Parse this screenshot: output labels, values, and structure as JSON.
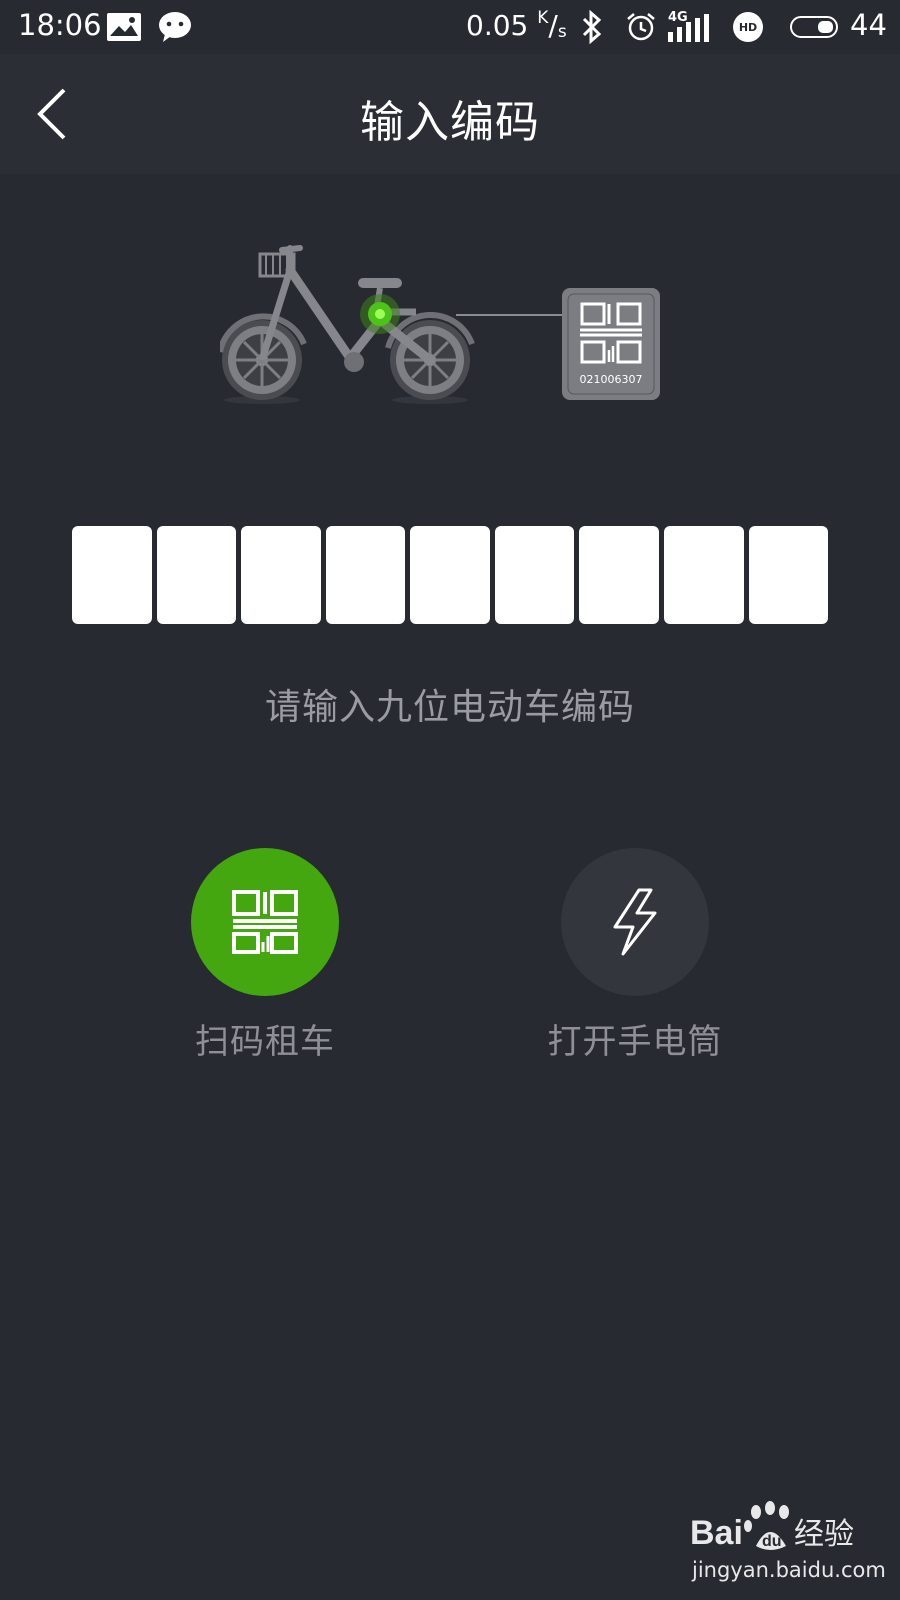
{
  "status_bar": {
    "time": "18:06",
    "speed_value": "0.05",
    "speed_unit_top": "K",
    "speed_unit_bottom": "s",
    "network": "4G",
    "hd_badge": "HD",
    "battery": "44",
    "icons": [
      "image-notification-icon",
      "wechat-icon",
      "bluetooth-icon",
      "alarm-icon",
      "signal-icon",
      "hd-icon",
      "battery-icon"
    ]
  },
  "header": {
    "title": "输入编码",
    "back_icon": "chevron-left-icon"
  },
  "illustration": {
    "qr_code_number": "021006307"
  },
  "code_input": {
    "box_count": 9,
    "values": [
      "",
      "",
      "",
      "",
      "",
      "",
      "",
      "",
      ""
    ],
    "hint": "请输入九位电动车编码"
  },
  "actions": {
    "scan": {
      "label": "扫码租车",
      "icon": "qr-code-icon",
      "color": "#45a70f"
    },
    "flashlight": {
      "label": "打开手电筒",
      "icon": "lightning-icon",
      "color": "#33363d"
    }
  },
  "watermark": {
    "brand": "Bai经验",
    "url": "jingyan.baidu.com"
  }
}
